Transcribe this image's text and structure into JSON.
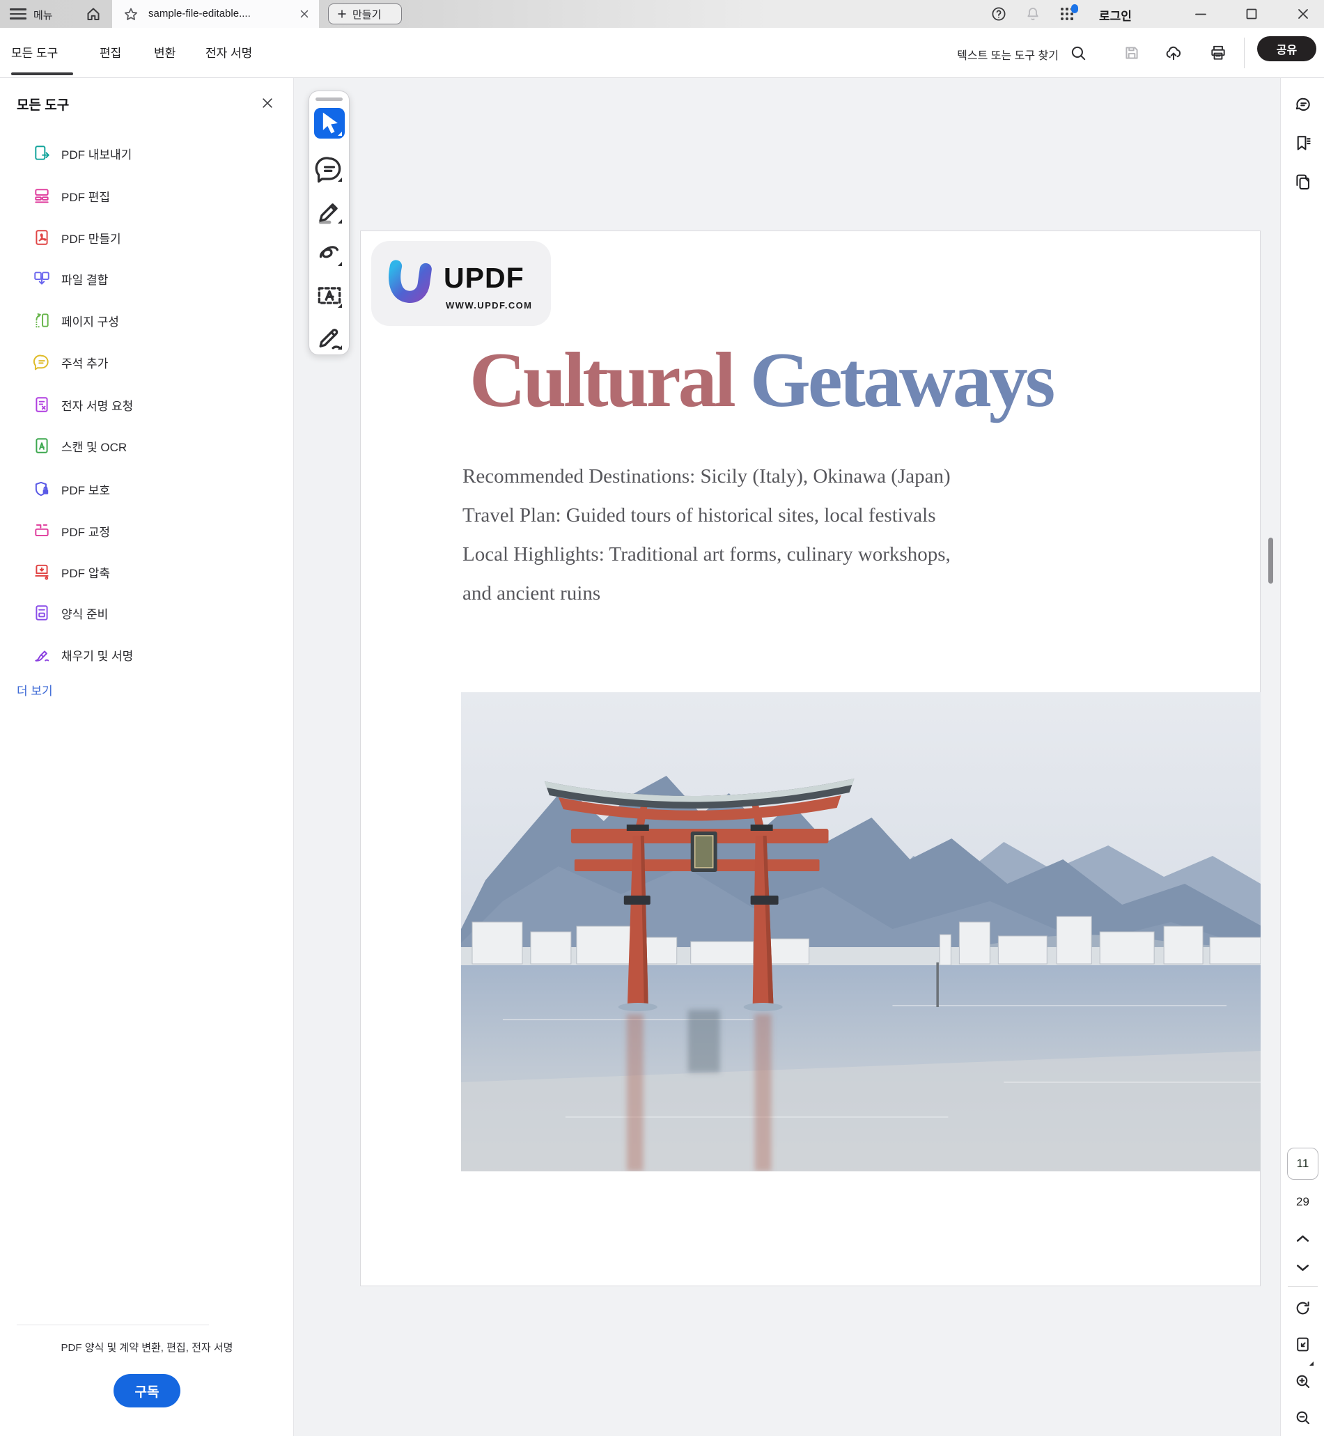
{
  "titlebar": {
    "menu_button": "메뉴",
    "tab_title": "sample-file-editable....",
    "new_tab_button": "만들기",
    "login": "로그인"
  },
  "toolbar": {
    "menus": [
      {
        "name": "all-tools",
        "label": "모든 도구",
        "active": true
      },
      {
        "name": "edit",
        "label": "편집",
        "active": false
      },
      {
        "name": "convert",
        "label": "변환",
        "active": false
      },
      {
        "name": "esign",
        "label": "전자 서명",
        "active": false
      }
    ],
    "search_placeholder": "텍스트 또는 도구 찾기",
    "share": "공유"
  },
  "sidebar": {
    "title": "모든 도구",
    "items": [
      {
        "name": "pdf-export",
        "label": "PDF 내보내기",
        "icon": "doc-arrow",
        "color": "#11a39a"
      },
      {
        "name": "pdf-edit",
        "label": "PDF 편집",
        "icon": "blocks",
        "color": "#df3a9c"
      },
      {
        "name": "pdf-create",
        "label": "PDF 만들기",
        "icon": "doc-pdf",
        "color": "#e04545"
      },
      {
        "name": "combine-files",
        "label": "파일 결합",
        "icon": "combine",
        "color": "#6b66ee"
      },
      {
        "name": "organize-pages",
        "label": "페이지 구성",
        "icon": "organize",
        "color": "#67b54b"
      },
      {
        "name": "add-comment",
        "label": "주석 추가",
        "icon": "bubble",
        "color": "#dfbc2a"
      },
      {
        "name": "request-esign",
        "label": "전자 서명 요청",
        "icon": "doc-sign",
        "color": "#b03fe0"
      },
      {
        "name": "scan-ocr",
        "label": "스캔 및 OCR",
        "icon": "doc-a",
        "color": "#3da84f"
      },
      {
        "name": "protect-pdf",
        "label": "PDF 보호",
        "icon": "shield",
        "color": "#5a5ae6"
      },
      {
        "name": "redact-pdf",
        "label": "PDF 교정",
        "icon": "redact",
        "color": "#df3a9c"
      },
      {
        "name": "compress-pdf",
        "label": "PDF 압축",
        "icon": "compress",
        "color": "#e04040"
      },
      {
        "name": "prepare-form",
        "label": "양식 준비",
        "icon": "form",
        "color": "#8a4de8"
      },
      {
        "name": "fill-sign",
        "label": "채우기 및 서명",
        "icon": "pen",
        "color": "#8a3fe0"
      }
    ],
    "more": "더 보기",
    "promo": "PDF 양식 및 계약 변환, 편집, 전자 서명",
    "subscribe": "구독"
  },
  "floatbar": {
    "tools": [
      {
        "name": "select-cursor",
        "icon": "cursor",
        "active": true
      },
      {
        "name": "add-comment",
        "icon": "comment",
        "active": false
      },
      {
        "name": "highlight",
        "icon": "highlighter",
        "active": false
      },
      {
        "name": "freehand-draw",
        "icon": "squiggle",
        "active": false
      },
      {
        "name": "select-text",
        "icon": "text-select",
        "active": false
      },
      {
        "name": "fill-sign",
        "icon": "sign-pen",
        "active": false
      }
    ]
  },
  "rightrail": {
    "panels": [
      {
        "name": "comments-panel",
        "icon": "rail-comment"
      },
      {
        "name": "bookmarks-panel",
        "icon": "rail-bookmark"
      },
      {
        "name": "page-thumbnails-panel",
        "icon": "rail-copies"
      }
    ]
  },
  "pager": {
    "current": "11",
    "total": "29"
  },
  "doc": {
    "logo_brand": "UPDF",
    "logo_url": "WWW.UPDF.COM",
    "title_red": "Cultural ",
    "title_blue": "Getaways",
    "lines": [
      "Recommended Destinations: Sicily (Italy), Okinawa (Japan)",
      "Travel Plan: Guided tours of historical sites, local festivals",
      "Local Highlights: Traditional art forms, culinary workshops,",
      "and ancient ruins"
    ]
  },
  "colors": {
    "accent_blue": "#1168e8",
    "share_bg": "#242122",
    "subscribe_bg": "#1567e0",
    "title_red": "#b26b70",
    "title_blue": "#7187b4"
  }
}
